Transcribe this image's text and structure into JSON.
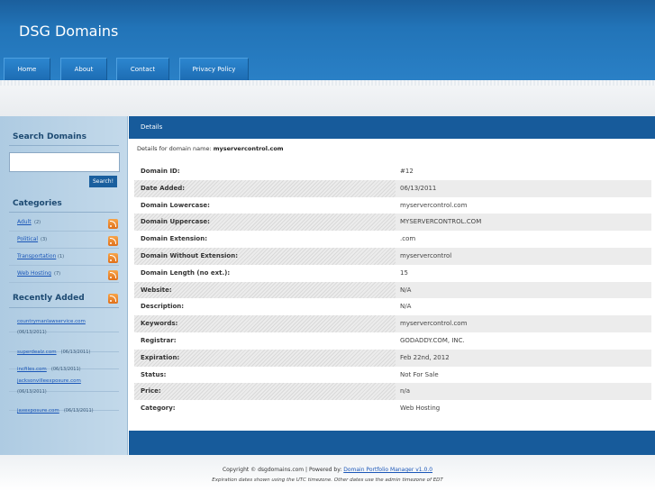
{
  "site": {
    "title": "DSG Domains"
  },
  "nav": [
    {
      "label": "Home"
    },
    {
      "label": "About"
    },
    {
      "label": "Contact"
    },
    {
      "label": "Privacy Policy"
    }
  ],
  "sidebar": {
    "search_heading": "Search Domains",
    "search_input_value": "",
    "search_button_label": "Search!",
    "categories_heading": "Categories",
    "categories": [
      {
        "name": "Adult",
        "count": "(2)"
      },
      {
        "name": "Political",
        "count": "(3)"
      },
      {
        "name": "Transportation",
        "count": "(1)"
      },
      {
        "name": "Web Hosting",
        "count": "(7)"
      }
    ],
    "recent_heading": "Recently Added",
    "recent": [
      {
        "domain": "countrymanlawservice.com",
        "date": "(06/13/2011)"
      },
      {
        "domain": "superdealz.com",
        "date": "(06/13/2011)"
      },
      {
        "domain": "incfiles.com",
        "date": "(06/13/2011)"
      },
      {
        "domain": "jacksonvilleexposure.com",
        "date": "(06/13/2011)"
      },
      {
        "domain": "jaxexposure.com",
        "date": "(06/13/2011)"
      }
    ]
  },
  "main": {
    "header": "Details",
    "intro_prefix": "Details for domain name: ",
    "domain_name": "myservercontrol.com",
    "rows": [
      {
        "label": "Domain ID:",
        "value": "#12"
      },
      {
        "label": "Date Added:",
        "value": "06/13/2011"
      },
      {
        "label": "Domain Lowercase:",
        "value": "myservercontrol.com"
      },
      {
        "label": "Domain Uppercase:",
        "value": "MYSERVERCONTROL.COM"
      },
      {
        "label": "Domain Extension:",
        "value": ".com"
      },
      {
        "label": "Domain Without Extension:",
        "value": "myservercontrol"
      },
      {
        "label": "Domain Length (no ext.):",
        "value": "15"
      },
      {
        "label": "Website:",
        "value": "N/A"
      },
      {
        "label": "Description:",
        "value": "N/A"
      },
      {
        "label": "Keywords:",
        "value": "myservercontrol.com"
      },
      {
        "label": "Registrar:",
        "value": "GODADDY.COM, INC."
      },
      {
        "label": "Expiration:",
        "value": "Feb 22nd, 2012"
      },
      {
        "label": "Status:",
        "value": "Not For Sale"
      },
      {
        "label": "Price:",
        "value": "n/a"
      },
      {
        "label": "Category:",
        "value": "Web Hosting"
      }
    ]
  },
  "footer": {
    "copyright": "Copyright © dsgdomains.com | Powered by: ",
    "link_label": "Domain Portfolio Manager v1.0.0",
    "note": "Expiration dates shown using the UTC timezone. Other dates use the admin timezone of EDT"
  }
}
